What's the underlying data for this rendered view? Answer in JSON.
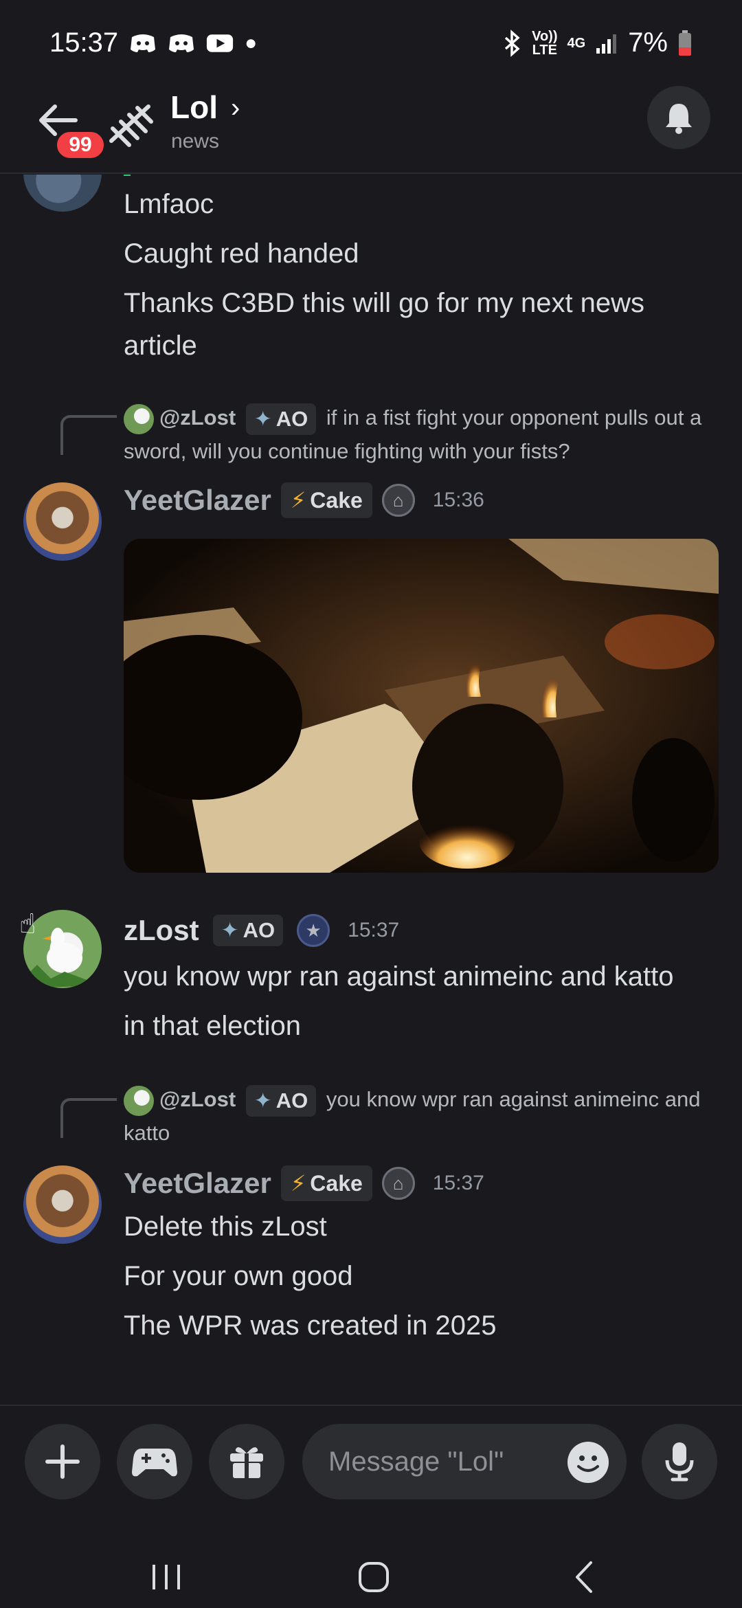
{
  "status_bar": {
    "time": "15:37",
    "volte_label": "Vo))\nLTE",
    "network_label": "4G",
    "battery": "7%"
  },
  "header": {
    "unread_badge": "99",
    "channel_name": "Lol",
    "channel_subtitle": "news"
  },
  "messages": {
    "prev_lines": [
      "Lmfaoc",
      "Caught red handed",
      "Thanks C3BD this will go for my next news article"
    ],
    "reply1": {
      "mention": "@zLost",
      "role": "AO",
      "text": "if in a fist fight your opponent pulls out a sword, will you continue fighting with your fists?"
    },
    "msg1": {
      "username": "YeetGlazer",
      "tag": "Cake",
      "time": "15:36"
    },
    "msg2": {
      "username": "zLost",
      "tag": "AO",
      "time": "15:37",
      "lines": [
        "you know wpr ran against animeinc and katto",
        "in that election"
      ]
    },
    "reply2": {
      "mention": "@zLost",
      "role": "AO",
      "text": "you know wpr ran against animeinc and katto"
    },
    "msg3": {
      "username": "YeetGlazer",
      "tag": "Cake",
      "time": "15:37",
      "lines": [
        "Delete this zLost",
        "For your own good",
        "The WPR was created in 2025"
      ]
    }
  },
  "composer": {
    "placeholder": "Message \"Lol\""
  },
  "colors": {
    "background": "#1a1a1e",
    "surface": "#2b2d31",
    "badge": "#f23f43",
    "yeetglazer": "#a8acb3",
    "zlost": "#dbdee1"
  }
}
